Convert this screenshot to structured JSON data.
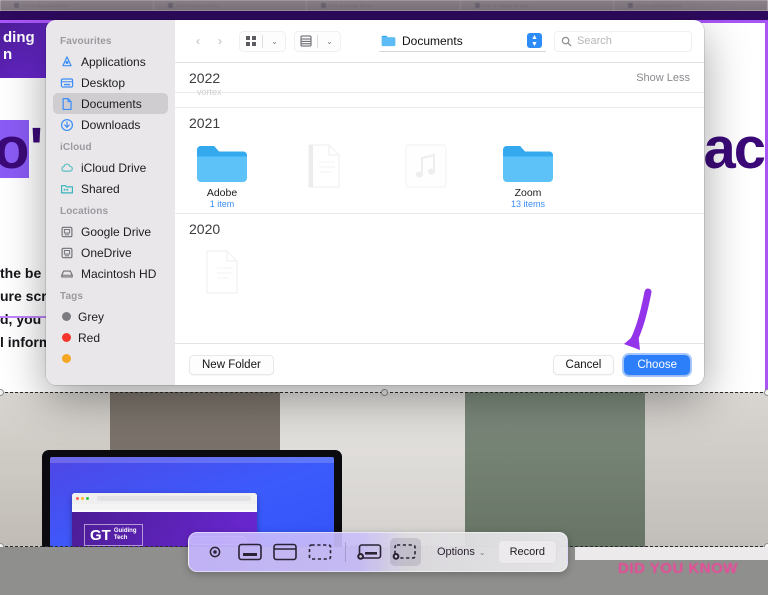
{
  "browser": {
    "tabs": [
      {
        "title": "How to take screenshot"
      },
      {
        "title": "How to record a video"
      },
      {
        "title": "How to change file loc"
      },
      {
        "title": "How to change file type"
      },
      {
        "title": "How to edit screenshot"
      }
    ]
  },
  "background_page": {
    "banner_line1": "ding",
    "banner_line2": "n",
    "heading_left": "o",
    "heading_left_suffix": "'",
    "heading_right": "ac",
    "body_lines": [
      "the be",
      "ure scr",
      "d, you",
      "l inform"
    ]
  },
  "panel": {
    "sidebar": {
      "sections": [
        {
          "header": "Favourites",
          "items": [
            {
              "label": "Applications",
              "icon": "applications-icon",
              "active": false
            },
            {
              "label": "Desktop",
              "icon": "desktop-icon",
              "active": false
            },
            {
              "label": "Documents",
              "icon": "document-icon",
              "active": true
            },
            {
              "label": "Downloads",
              "icon": "downloads-icon",
              "active": false
            }
          ]
        },
        {
          "header": "iCloud",
          "items": [
            {
              "label": "iCloud Drive",
              "icon": "cloud-icon",
              "active": false
            },
            {
              "label": "Shared",
              "icon": "shared-folder-icon",
              "active": false
            }
          ]
        },
        {
          "header": "Locations",
          "items": [
            {
              "label": "Google Drive",
              "icon": "external-drive-icon",
              "active": false
            },
            {
              "label": "OneDrive",
              "icon": "external-drive-icon",
              "active": false
            },
            {
              "label": "Macintosh HD",
              "icon": "hard-drive-icon",
              "active": false
            }
          ]
        },
        {
          "header": "Tags",
          "tags": [
            {
              "label": "Grey",
              "color": "#7c7c80"
            },
            {
              "label": "Red",
              "color": "#f5342b"
            },
            {
              "label": "",
              "color": "#f5a623"
            }
          ]
        }
      ]
    },
    "toolbar": {
      "back_glyph": "‹",
      "forward_glyph": "›",
      "view_icon": "grid-view-icon",
      "arrange_icon": "list-view-icon",
      "chevron": "⌄",
      "path_label": "Documents",
      "path_folder_icon": "folder-icon",
      "stepper_icon": "stepper-up-down-icon",
      "search_icon": "search-icon",
      "search_placeholder": "Search",
      "search_value": ""
    },
    "groups": [
      {
        "year": "2022",
        "show_less_label": "Show Less",
        "partial_label": "vortex",
        "items": []
      },
      {
        "year": "2021",
        "items": [
          {
            "name": "Adobe",
            "count": "1 item",
            "icon": "folder-icon",
            "ghost": false
          },
          {
            "name": "",
            "count": "",
            "icon": "document-icon",
            "ghost": true
          },
          {
            "name": "",
            "count": "",
            "icon": "music-file-icon",
            "ghost": true
          },
          {
            "name": "Zoom",
            "count": "13 items",
            "icon": "folder-icon",
            "ghost": false
          }
        ]
      },
      {
        "year": "2020",
        "items": [
          {
            "name": "",
            "count": "",
            "icon": "document-icon",
            "ghost": true
          }
        ]
      }
    ],
    "footer": {
      "new_folder_label": "New Folder",
      "cancel_label": "Cancel",
      "choose_label": "Choose"
    }
  },
  "screenshot_toolbar": {
    "buttons": [
      {
        "name": "capture-entire-screen",
        "selected": false
      },
      {
        "name": "capture-selected-window",
        "selected": false
      },
      {
        "name": "capture-selected-portion",
        "selected": false
      },
      {
        "name": "record-entire-screen",
        "selected": false
      },
      {
        "name": "record-selected-portion",
        "selected": true
      }
    ],
    "options_label": "Options",
    "options_chevron": "⌄",
    "record_label": "Record"
  },
  "overlay": {
    "did_you_know": "DID YOU KNOW",
    "annotation_arrow": "purple-arrow-icon",
    "laptop_brand_line1": "Guiding",
    "laptop_brand_line2": "Tech",
    "laptop_brand_mark": "GT"
  },
  "colors": {
    "accent_blue": "#2d7ff9",
    "annotation_purple": "#9333ea",
    "brand_purple": "#4c1d95",
    "pink": "#ec4899"
  }
}
